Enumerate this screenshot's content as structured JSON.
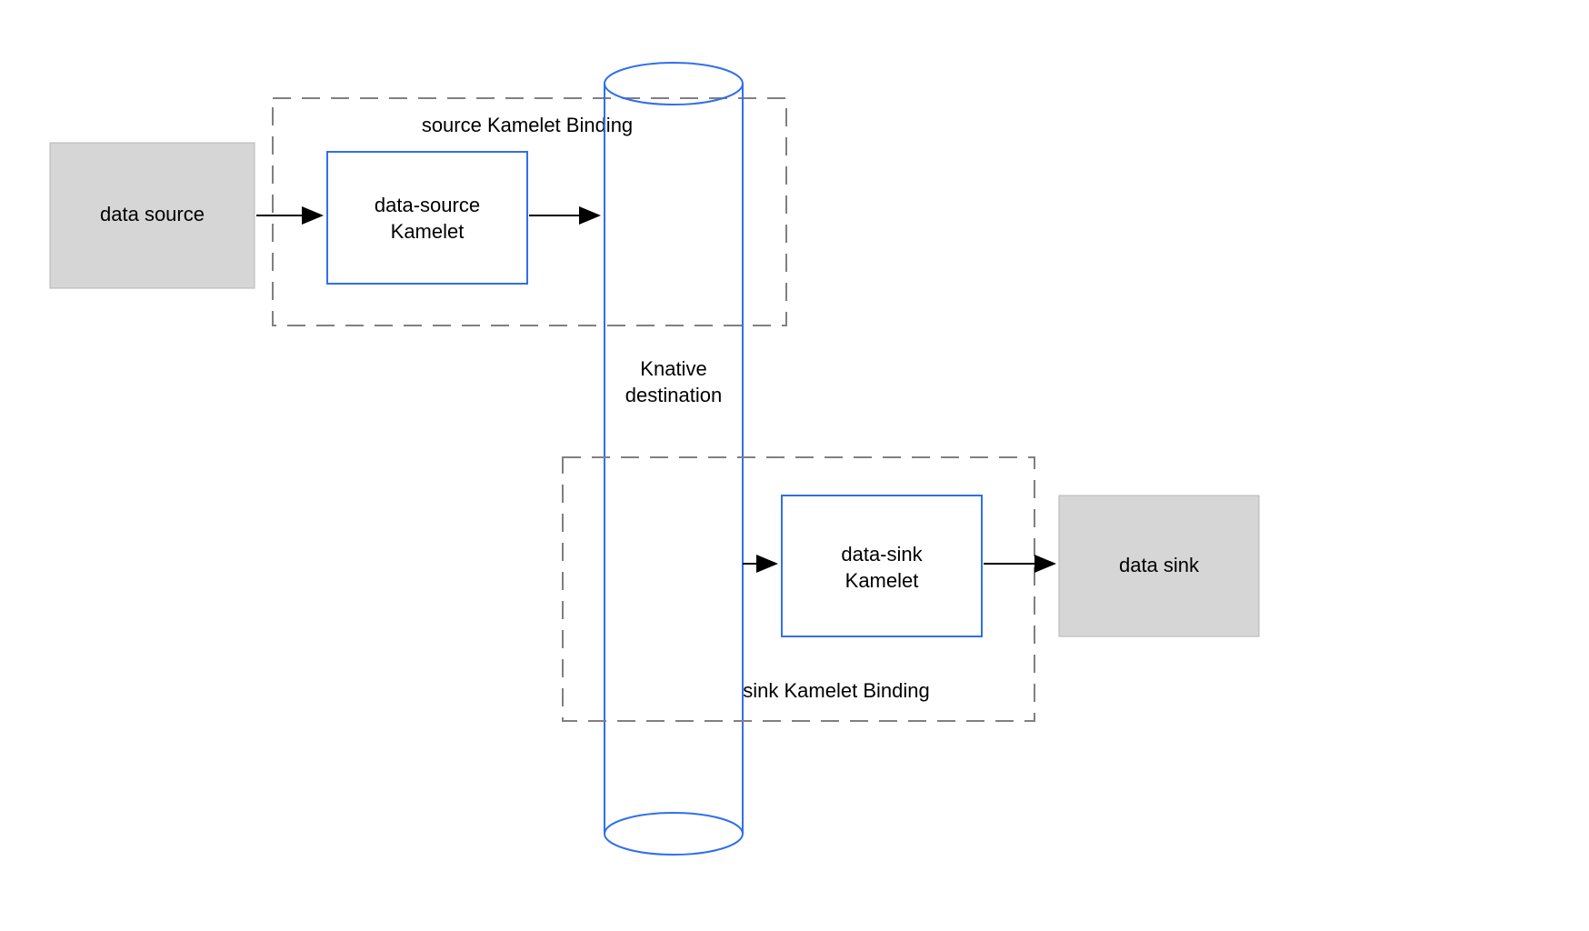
{
  "labels": {
    "data_source": "data source",
    "source_binding_title": "source Kamelet Binding",
    "data_source_kamelet_line1": "data-source",
    "data_source_kamelet_line2": "Kamelet",
    "knative_line1": "Knative",
    "knative_line2": "destination",
    "sink_binding_title": "sink Kamelet Binding",
    "data_sink_kamelet_line1": "data-sink",
    "data_sink_kamelet_line2": "Kamelet",
    "data_sink": "data sink"
  },
  "colors": {
    "gray_fill": "#d6d6d6",
    "gray_stroke": "#b0b0b0",
    "blue_stroke": "#2f6fed",
    "dashed_stroke": "#888888",
    "arrow_black": "#000000"
  }
}
